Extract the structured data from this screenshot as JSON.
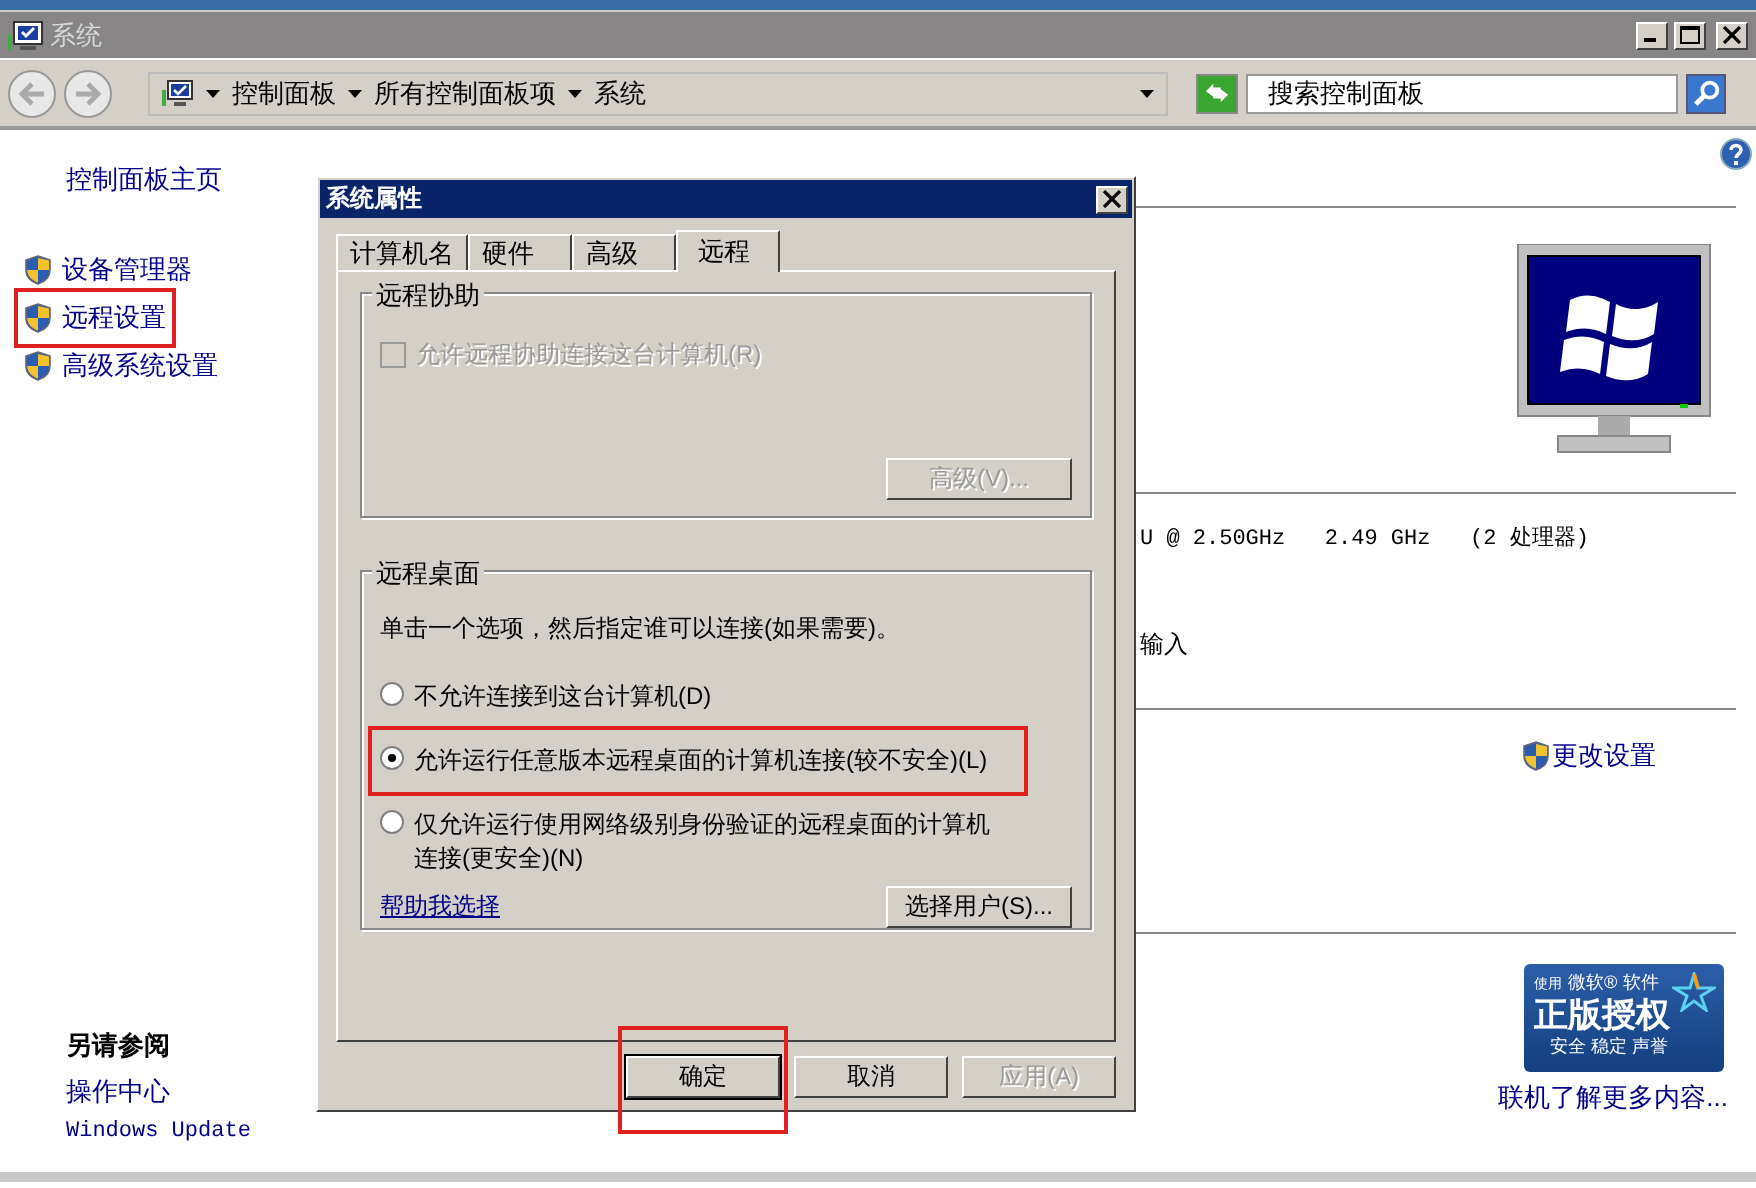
{
  "window": {
    "title": "系统"
  },
  "address_bar": {
    "breadcrumb": [
      "控制面板",
      "所有控制面板项",
      "系统"
    ],
    "search": {
      "placeholder": "搜索控制面板"
    }
  },
  "sidebar": {
    "home": "控制面板主页",
    "items": [
      {
        "label": "设备管理器",
        "highlighted": false
      },
      {
        "label": "远程设置",
        "highlighted": true
      },
      {
        "label": "高级系统设置",
        "highlighted": false
      }
    ],
    "see_also": {
      "title": "另请参阅",
      "links": [
        "操作中心",
        "Windows Update"
      ]
    }
  },
  "main": {
    "processor": "U @ 2.50GHz   2.49 GHz   (2 处理器)",
    "input": "输入",
    "change_settings": "更改设置",
    "genuine_badge": {
      "top": [
        "使用",
        "微软®",
        "软件"
      ],
      "title": "正版授权",
      "bottom": "安全 稳定 声誉"
    },
    "learn_more": "联机了解更多内容..."
  },
  "dialog": {
    "title": "系统属性",
    "tabs": [
      {
        "label": "计算机名",
        "selected": false
      },
      {
        "label": "硬件",
        "selected": false
      },
      {
        "label": "高级",
        "selected": false
      },
      {
        "label": "远程",
        "selected": true
      }
    ],
    "remote_assistance": {
      "title": "远程协助",
      "checkbox": {
        "label": "允许远程协助连接这台计算机(R)",
        "checked": false,
        "disabled": true
      },
      "button": {
        "label": "高级(V)...",
        "disabled": true
      }
    },
    "remote_desktop": {
      "title": "远程桌面",
      "description": "单击一个选项，然后指定谁可以连接(如果需要)。",
      "options": [
        {
          "label": "不允许连接到这台计算机(D)",
          "selected": false,
          "highlighted": false
        },
        {
          "label": "允许运行任意版本远程桌面的计算机连接(较不安全)(L)",
          "selected": true,
          "highlighted": true
        },
        {
          "label": "仅允许运行使用网络级别身份验证的远程桌面的计算机连接(更安全)(N)",
          "selected": false,
          "highlighted": false
        }
      ],
      "help_link": "帮助我选择",
      "select_users": "选择用户(S)..."
    },
    "buttons": [
      {
        "label": "确定",
        "default": true,
        "disabled": false,
        "highlighted": true
      },
      {
        "label": "取消",
        "default": false,
        "disabled": false,
        "highlighted": false
      },
      {
        "label": "应用(A)",
        "default": false,
        "disabled": true,
        "highlighted": false
      }
    ]
  }
}
